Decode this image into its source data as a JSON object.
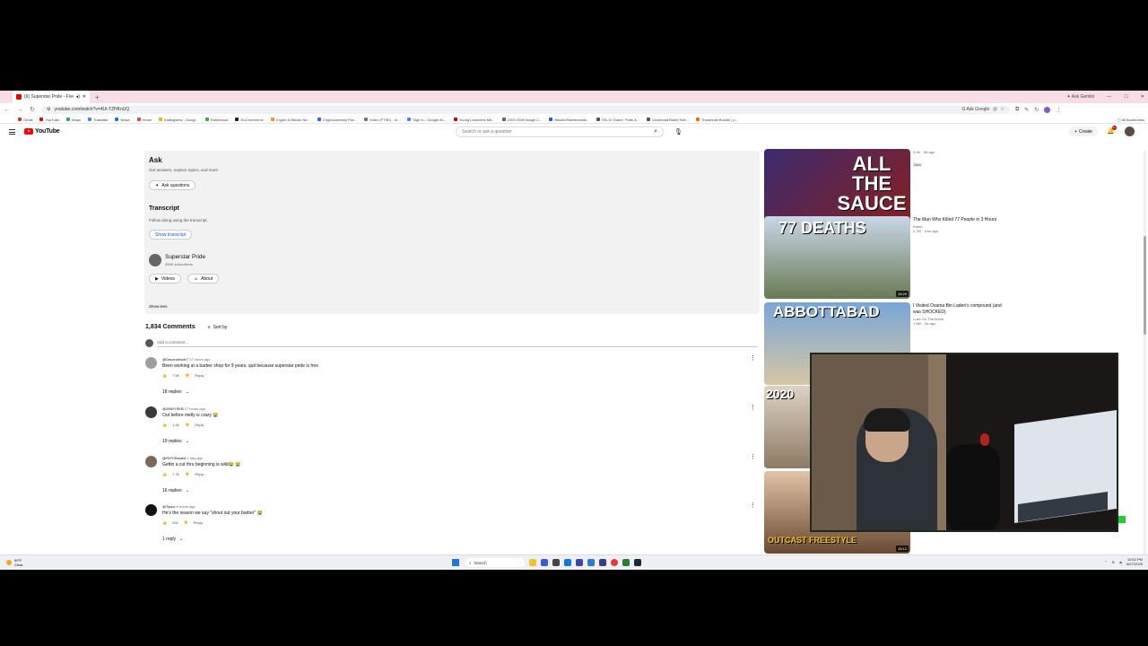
{
  "browser": {
    "tab_title": "(9) Superstar Pride - Five B...",
    "tab_count": "9",
    "ask_gemini": "Ask Gemini",
    "url": "youtube.com/watch?v=4Ui-TZHKnUQ",
    "ask_google": "Ask Google",
    "all_bookmarks": "All Bookmarks",
    "bookmarks": [
      "Gmail",
      "YouTube",
      "Maps",
      "Translate",
      "News",
      "Home",
      "tradingview - Googl...",
      "Robinhood",
      "DUCommerce",
      "Crypto & Bitcoin Ne...",
      "Cryptocurrency Pric...",
      "Index (FTSE) - In...",
      "Sign in - Google Ac...",
      "Young Launches Me...",
      "2003-2008 Image C...",
      "Bitcoin/Stablecreate...",
      "RA-10 Game, Parts &...",
      "Download Blahd Soft...",
      "Thumbnail Bundle | p..."
    ]
  },
  "youtube": {
    "logo_text": "YouTube",
    "search_placeholder": "Search or ask a question",
    "create_label": "Create",
    "notif_count": "9+"
  },
  "description": {
    "ask_title": "Ask",
    "ask_sub": "Get answers, explore topics, and more",
    "ask_button": "Ask questions",
    "transcript_title": "Transcript",
    "transcript_sub": "Follow along using the transcript.",
    "transcript_button": "Show transcript",
    "channel_name": "Superstar Pride",
    "channel_subs": "396K subscribers",
    "videos_button": "Videos",
    "about_button": "About",
    "show_less": "Show less"
  },
  "comments": {
    "count": "1,834 Comments",
    "sort_by": "Sort by",
    "add_placeholder": "Add a comment...",
    "items": [
      {
        "author": "@Deconstructr7",
        "time": "17 hours ago",
        "text": "Been working at a barber shop for 9 years, quit because superstar pride is free",
        "likes": "7.5K",
        "reply": "Reply",
        "replies": "18 replies"
      },
      {
        "author": "@2NWYSKB",
        "time": "17 hours ago",
        "text": "Out before melly is crazy 😭",
        "likes": "1.4K",
        "reply": "Reply",
        "replies": "19 replies"
      },
      {
        "author": "@RHYShaded",
        "time": "1 day ago",
        "text": "Gettin a cut thru beginning is wild😂 😭",
        "likes": "7.7K",
        "reply": "Reply",
        "replies": "16 replies"
      },
      {
        "author": "@Tysco",
        "time": "6 hours ago",
        "text": "He's the reason we say \"shout out your barber\" 😭",
        "likes": "326",
        "reply": "Reply",
        "replies": "1 reply"
      }
    ]
  },
  "recommendations": [
    {
      "thumb_text": "ALL THE SAUCE",
      "duration": "1:40:56",
      "title": "",
      "channel": "",
      "views": "3.4K · 5d ago",
      "badge": "New"
    },
    {
      "thumb_text": "77 DEATHS",
      "duration": "16:29",
      "title": "The Man Who Killed 77 People in 3 Hours",
      "channel": "Kanto",
      "views": "2.7M · 1mo ago",
      "badge": ""
    },
    {
      "thumb_text": "ABBOTTABAD",
      "duration": "",
      "title": "I Visited Osama Bin Laden's compound (and was SHOCKED)",
      "channel": "Luke On The Move",
      "views": "1.5M · 2w ago",
      "badge": ""
    },
    {
      "thumb_text": "2020",
      "duration": "",
      "title": "",
      "channel": "",
      "views": "",
      "badge": ""
    },
    {
      "thumb_text": "OUTCAST FREESTYLE",
      "duration": "15:12",
      "title": "",
      "channel": "",
      "views": "",
      "badge": ""
    }
  ],
  "taskbar": {
    "temp": "59°F",
    "weather": "Clear",
    "search": "Search",
    "time": "10:52 PM",
    "date": "8/27/2025"
  }
}
